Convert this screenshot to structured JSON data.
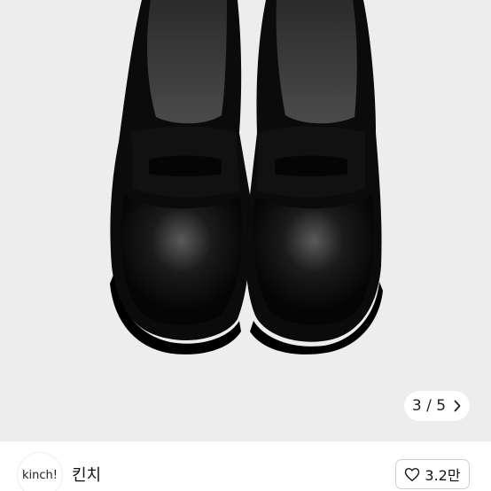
{
  "gallery": {
    "image_alt": "black leather penny loafers",
    "page_counter": "3 / 5",
    "next_icon": "chevron-right-icon"
  },
  "store": {
    "logo_text": "kinch!",
    "name": "킨치"
  },
  "like": {
    "icon": "heart-outline-icon",
    "count": "3.2만"
  },
  "colors": {
    "image_background": "#ededed",
    "shoe_leather": "#0b0b0b",
    "button_border": "#cfcfcf",
    "text": "#111111"
  }
}
